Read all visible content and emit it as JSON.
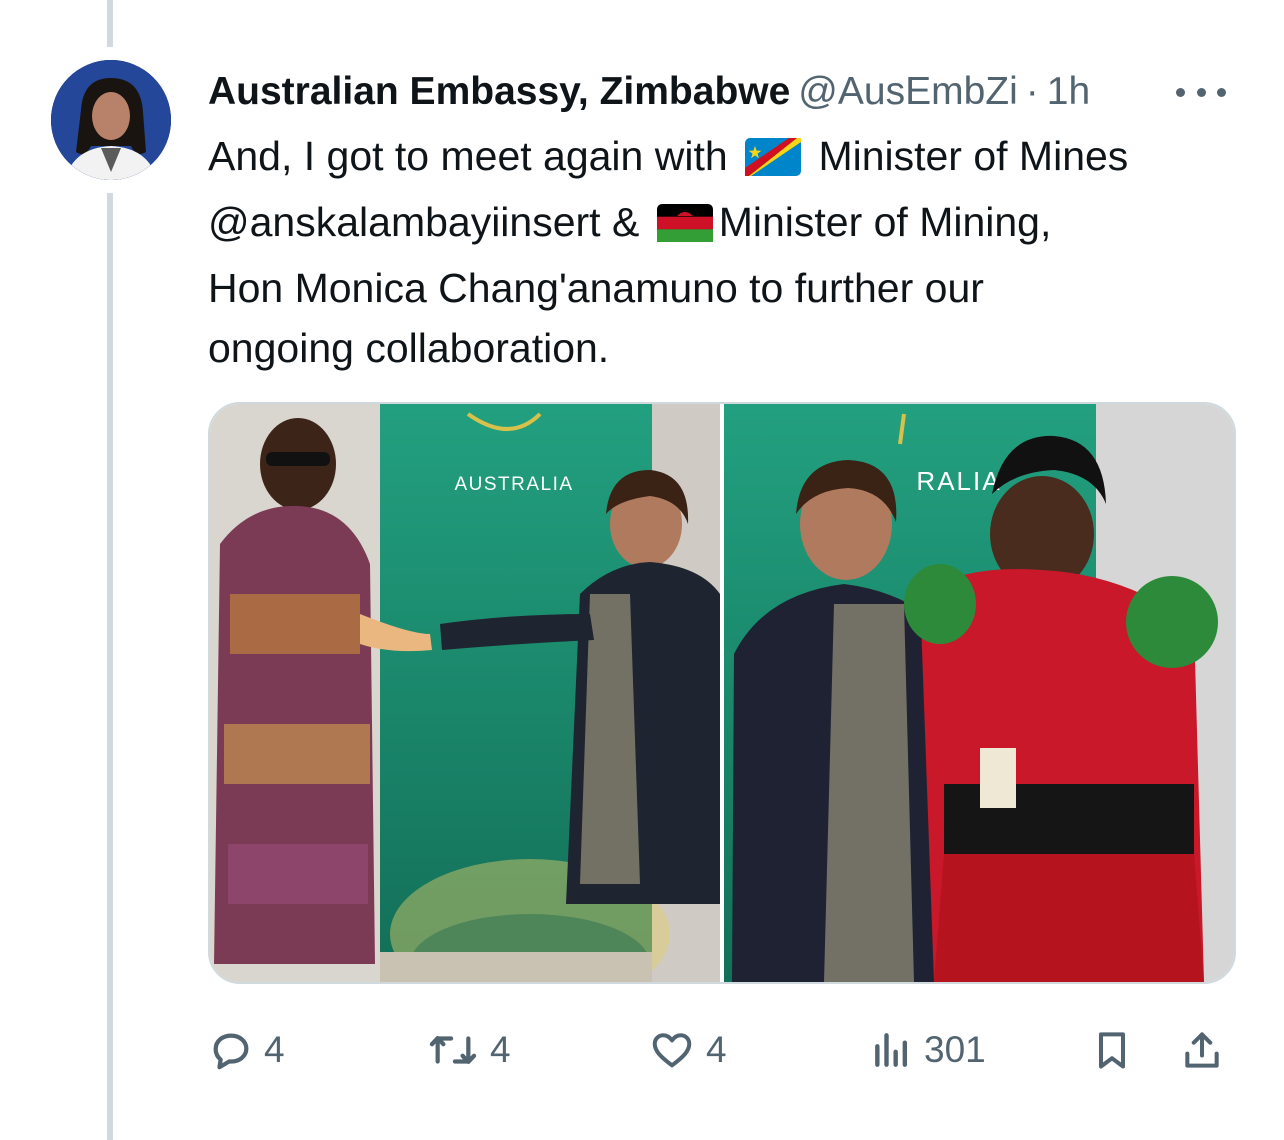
{
  "tweet": {
    "author_name": "Australian Embassy, Zimbabwe",
    "handle": "@AusEmbZi",
    "separator": "·",
    "time": "1h",
    "text": {
      "line1_before_flag": "And, I got to meet again with ",
      "line1_after_flag": " Minister of Mines",
      "line2_before_flag": "@anskalambayiinsert & ",
      "line2_after_flag": "Minister of Mining,",
      "line3": "Hon Monica Chang'anamuno to further our",
      "line4": "ongoing collaboration."
    },
    "flags": [
      "drc-flag-icon",
      "malawi-flag-icon"
    ],
    "media": {
      "photo_left": {
        "banner_text": "AUSTRALIA"
      },
      "photo_right": {
        "banner_text": "RALIA"
      }
    },
    "stats": {
      "replies": "4",
      "retweets": "4",
      "likes": "4",
      "views": "301"
    }
  },
  "icons": {
    "reply": "reply-icon",
    "retweet": "retweet-icon",
    "like": "like-icon",
    "views": "views-icon",
    "bookmark": "bookmark-icon",
    "share": "share-icon",
    "more": "more-icon"
  },
  "colors": {
    "text_primary": "#0f1419",
    "text_secondary": "#536471",
    "border": "#cfd9de",
    "banner_green": "#1f8c73"
  }
}
